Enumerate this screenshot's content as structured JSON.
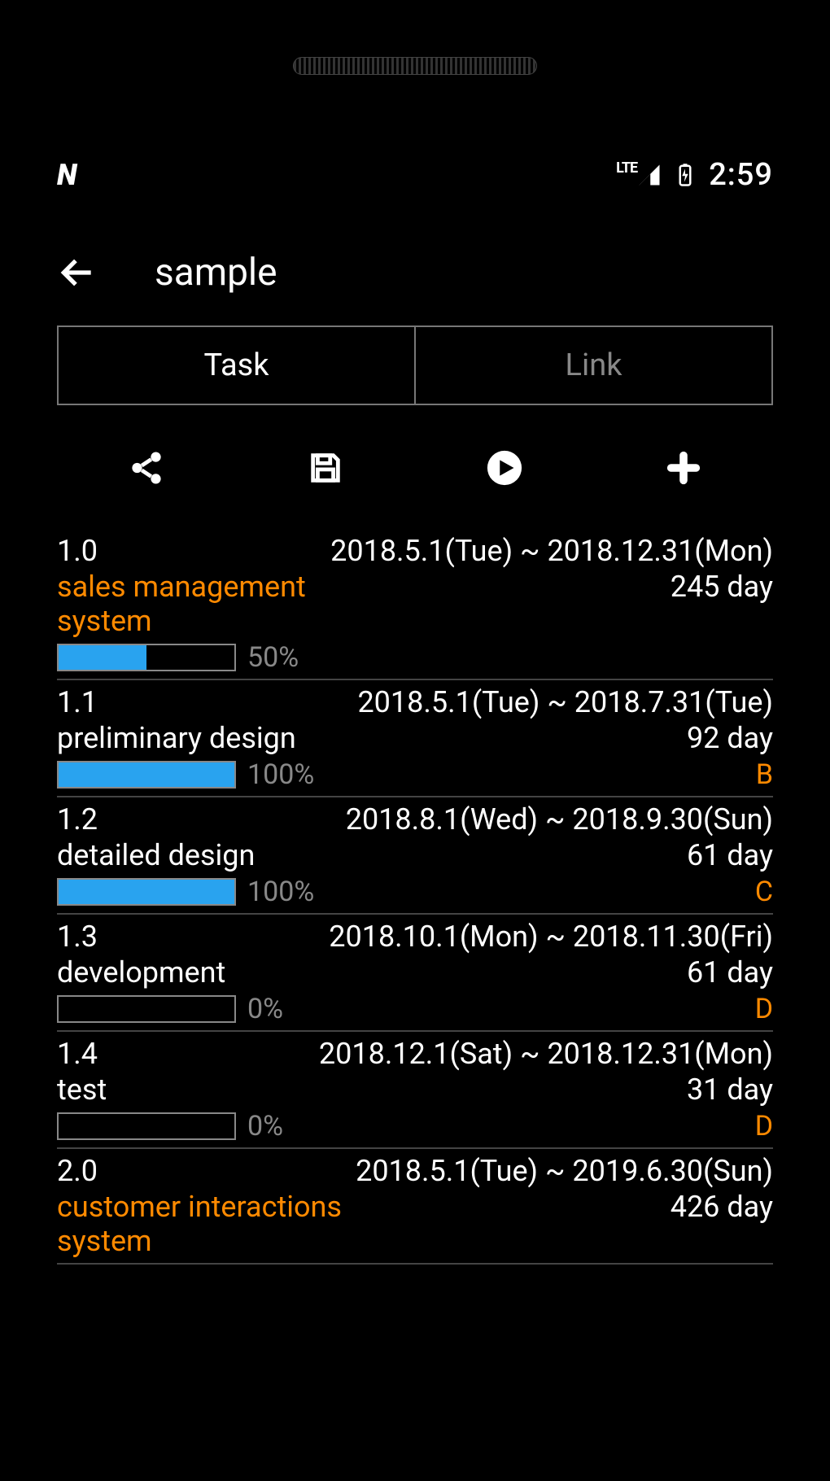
{
  "statusbar": {
    "carrier_icon": "N",
    "net_label": "LTE",
    "time": "2:59"
  },
  "header": {
    "title": "sample"
  },
  "tabs": {
    "task": "Task",
    "link": "Link",
    "active": "task"
  },
  "toolbar": {
    "share": "share-icon",
    "save": "save-icon",
    "play": "play-icon",
    "add": "add-icon"
  },
  "tasks": [
    {
      "id": "1.0",
      "name": "sales management system",
      "dates": "2018.5.1(Tue) ~ 2018.12.31(Mon)",
      "days": "245 day",
      "progress": 50,
      "progress_label": "50%",
      "grade": "",
      "parent": true
    },
    {
      "id": "1.1",
      "name": "preliminary design",
      "dates": "2018.5.1(Tue) ~ 2018.7.31(Tue)",
      "days": "92 day",
      "progress": 100,
      "progress_label": "100%",
      "grade": "B",
      "parent": false
    },
    {
      "id": "1.2",
      "name": "detailed design",
      "dates": "2018.8.1(Wed) ~ 2018.9.30(Sun)",
      "days": "61 day",
      "progress": 100,
      "progress_label": "100%",
      "grade": "C",
      "parent": false
    },
    {
      "id": "1.3",
      "name": "development",
      "dates": "2018.10.1(Mon) ~ 2018.11.30(Fri)",
      "days": "61 day",
      "progress": 0,
      "progress_label": "0%",
      "grade": "D",
      "parent": false
    },
    {
      "id": "1.4",
      "name": "test",
      "dates": "2018.12.1(Sat) ~ 2018.12.31(Mon)",
      "days": "31 day",
      "progress": 0,
      "progress_label": "0%",
      "grade": "D",
      "parent": false
    },
    {
      "id": "2.0",
      "name": "customer interactions system",
      "dates": "2018.5.1(Tue) ~ 2019.6.30(Sun)",
      "days": "426 day",
      "progress": null,
      "progress_label": "",
      "grade": "",
      "parent": true
    }
  ],
  "colors": {
    "accent": "#ff8a00",
    "progress": "#29a3ef",
    "dim": "#888"
  }
}
